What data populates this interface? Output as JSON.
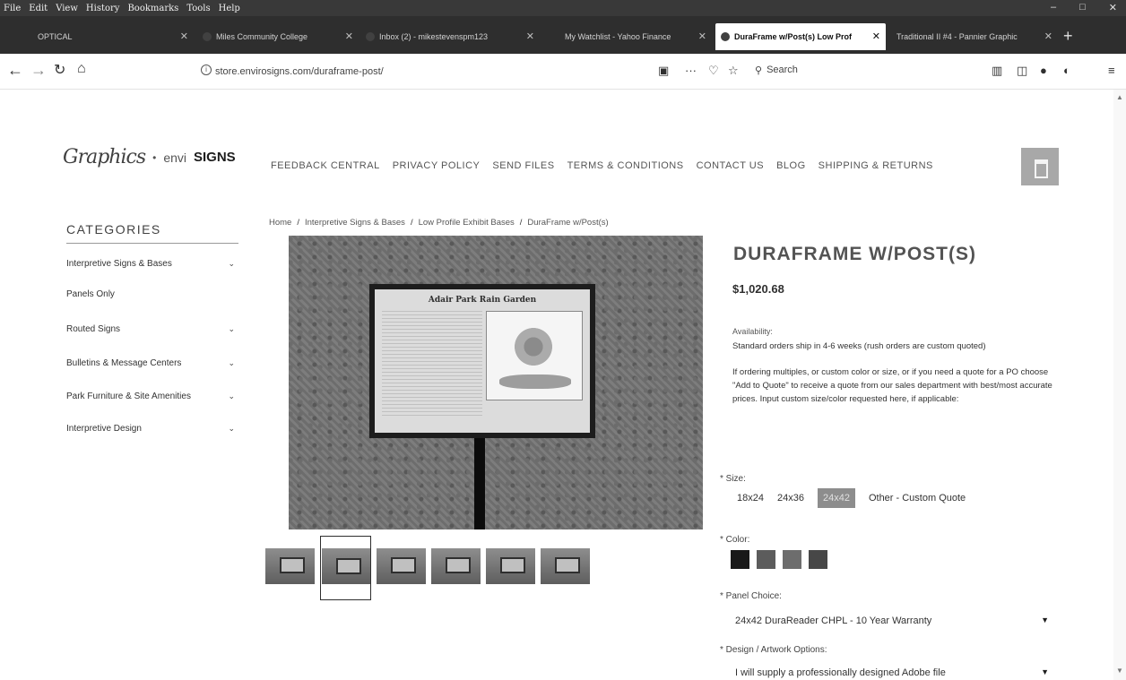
{
  "browser": {
    "menu": [
      "File",
      "Edit",
      "View",
      "History",
      "Bookmarks",
      "Tools",
      "Help"
    ],
    "tabs": [
      {
        "label": "OPTICAL"
      },
      {
        "label": "Miles Community College"
      },
      {
        "label": "Inbox (2) - mikestevenspm123"
      },
      {
        "label": "My Watchlist - Yahoo Finance"
      },
      {
        "label": "DuraFrame w/Post(s) Low Prof",
        "active": true
      },
      {
        "label": "Traditional II #4 - Pannier Graphic"
      }
    ],
    "url": "store.envirosigns.com/duraframe-post/",
    "search_placeholder": "Search"
  },
  "header": {
    "logo_script": "Graphics",
    "logo_sep": "•",
    "logo_envi": "envi",
    "logo_signs": "SIGNS",
    "nav": [
      "FEEDBACK CENTRAL",
      "PRIVACY POLICY",
      "SEND FILES",
      "TERMS & CONDITIONS",
      "CONTACT US",
      "BLOG",
      "SHIPPING & RETURNS"
    ]
  },
  "sidebar": {
    "title": "CATEGORIES",
    "items": [
      {
        "label": "Interpretive Signs & Bases",
        "expandable": true
      },
      {
        "label": "Panels Only",
        "expandable": false
      },
      {
        "label": "Routed Signs",
        "expandable": true
      },
      {
        "label": "Bulletins & Message Centers",
        "expandable": true
      },
      {
        "label": "Park Furniture & Site Amenities",
        "expandable": true
      },
      {
        "label": "Interpretive Design",
        "expandable": true
      }
    ]
  },
  "breadcrumb": [
    "Home",
    "Interpretive Signs & Bases",
    "Low Profile Exhibit Bases",
    "DuraFrame w/Post(s)"
  ],
  "gallery": {
    "sign_title": "Adair Park Rain Garden",
    "thumbnail_count": 6,
    "selected_thumbnail": 2
  },
  "product": {
    "title": "DURAFRAME W/POST(S)",
    "price": "$1,020.68",
    "availability_label": "Availability:",
    "availability_value": "Standard orders ship in 4-6 weeks (rush orders are custom quoted)",
    "description": "If ordering multiples, or custom color or size, or if you need a quote for a PO choose \"Add to Quote\" to receive a quote from our sales department with best/most accurate prices. Input custom size/color requested here, if applicable:",
    "size_label": "* Size:",
    "sizes": [
      "18x24",
      "24x36",
      "24x42",
      "Other - Custom Quote"
    ],
    "selected_size": "24x42",
    "color_label": "* Color:",
    "colors": [
      "#1e1e1e",
      "#5e5e5e",
      "#6e6e6e",
      "#4a4a4a"
    ],
    "panel_label": "* Panel Choice:",
    "panel_value": "24x42 DuraReader CHPL - 10 Year Warranty",
    "design_label": "* Design / Artwork Options:",
    "design_value": "I will supply a professionally designed Adobe file"
  }
}
